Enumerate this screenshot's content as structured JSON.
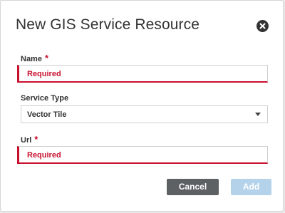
{
  "dialog": {
    "title": "New GIS Service Resource",
    "close_icon": "close-circle-icon"
  },
  "fields": {
    "name": {
      "label": "Name",
      "required_marker": "*",
      "value": "",
      "validation_message": "Required",
      "state": "error"
    },
    "service_type": {
      "label": "Service Type",
      "selected": "Vector Tile",
      "icon": "chevron-down-icon"
    },
    "url": {
      "label": "Url",
      "required_marker": "*",
      "value": "",
      "validation_message": "Required",
      "state": "error"
    }
  },
  "buttons": {
    "cancel_label": "Cancel",
    "add_label": "Add",
    "add_enabled": false
  },
  "colors": {
    "error": "#c8102e",
    "cancel_bg": "#5d6164",
    "add_bg_disabled": "#b4d3ea",
    "title_text": "#333333"
  }
}
